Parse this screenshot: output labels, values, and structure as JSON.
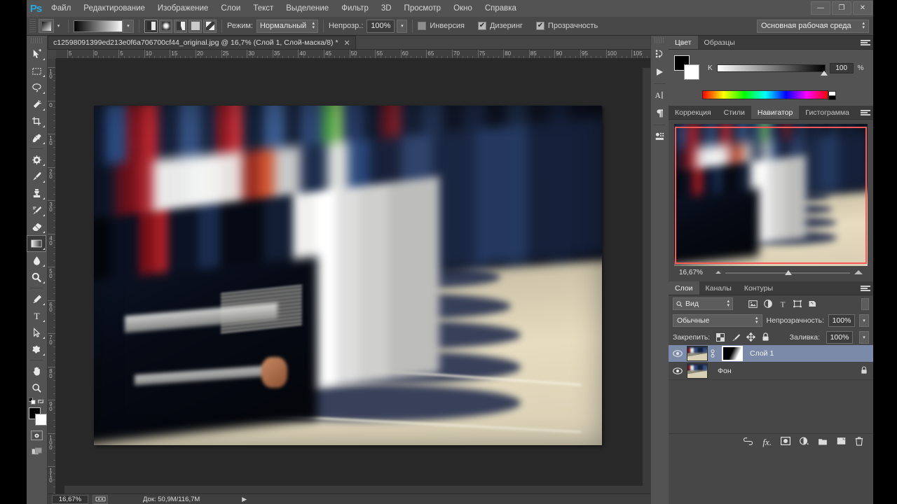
{
  "app": {
    "logo": "Ps"
  },
  "menubar": {
    "items": [
      "Файл",
      "Редактирование",
      "Изображение",
      "Слои",
      "Текст",
      "Выделение",
      "Фильтр",
      "3D",
      "Просмотр",
      "Окно",
      "Справка"
    ],
    "window_buttons": [
      "—",
      "❐",
      "✕"
    ]
  },
  "options_bar": {
    "mode_label": "Режим:",
    "mode_value": "Нормальный",
    "opacity_label": "Непрозр.:",
    "opacity_value": "100%",
    "checkboxes": [
      {
        "label": "Инверсия",
        "checked": false
      },
      {
        "label": "Дизеринг",
        "checked": true
      },
      {
        "label": "Прозрачность",
        "checked": true
      }
    ],
    "gradient_types": [
      "linear-gradient-icon",
      "radial-gradient-icon",
      "angle-gradient-icon",
      "reflected-gradient-icon",
      "diamond-gradient-icon"
    ],
    "workspace": "Основная рабочая среда"
  },
  "toolbar": {
    "tools": [
      {
        "name": "move-tool",
        "active": false
      },
      {
        "name": "rectangular-marquee-tool",
        "active": false
      },
      {
        "name": "lasso-tool",
        "active": false
      },
      {
        "name": "magic-wand-tool",
        "active": false
      },
      {
        "name": "crop-tool",
        "active": false
      },
      {
        "name": "eyedropper-tool",
        "active": false
      },
      {
        "name": "spot-healing-brush-tool",
        "active": false
      },
      {
        "name": "brush-tool",
        "active": false
      },
      {
        "name": "clone-stamp-tool",
        "active": false
      },
      {
        "name": "history-brush-tool",
        "active": false
      },
      {
        "name": "eraser-tool",
        "active": false
      },
      {
        "name": "gradient-tool",
        "active": true
      },
      {
        "name": "blur-tool",
        "active": false
      },
      {
        "name": "dodge-tool",
        "active": false
      },
      {
        "name": "pen-tool",
        "active": false
      },
      {
        "name": "type-tool",
        "active": false
      },
      {
        "name": "path-selection-tool",
        "active": false
      },
      {
        "name": "custom-shape-tool",
        "active": false
      },
      {
        "name": "hand-tool",
        "active": false
      },
      {
        "name": "zoom-tool",
        "active": false
      }
    ],
    "foreground_color": "#000000",
    "background_color": "#ffffff"
  },
  "document": {
    "tab_title": "c12598091399ed213e0f6a706700cf44_original.jpg @ 16,7% (Слой 1, Слой-маска/8) *",
    "close_glyph": "✕",
    "ruler_h_labels": [
      "5",
      "0",
      "5",
      "10",
      "15",
      "20",
      "25",
      "30",
      "35",
      "40",
      "45",
      "50",
      "55",
      "60",
      "65",
      "70",
      "75",
      "80",
      "85",
      "90",
      "95",
      "100",
      "105"
    ],
    "ruler_v_labels": [
      "10",
      "0",
      "10",
      "20",
      "30",
      "40",
      "50",
      "60",
      "70",
      "80",
      "90",
      "100",
      "110"
    ]
  },
  "dock_strip": {
    "buttons": [
      "history-icon",
      "actions-play-icon",
      "character-icon",
      "paragraph-icon",
      "properties-icon"
    ]
  },
  "color_panel": {
    "tabs": [
      {
        "label": "Цвет",
        "active": true
      },
      {
        "label": "Образцы",
        "active": false
      }
    ],
    "channel_label": "K",
    "channel_value": "100",
    "percent_symbol": "%",
    "foreground": "#000000",
    "background": "#ffffff"
  },
  "navigator_panel": {
    "tabs": [
      {
        "label": "Коррекция",
        "active": false
      },
      {
        "label": "Стили",
        "active": false
      },
      {
        "label": "Навигатор",
        "active": true
      },
      {
        "label": "Гистограмма",
        "active": false
      }
    ],
    "zoom_value": "16,67%",
    "view_box_color": "#ff5656"
  },
  "layers_panel": {
    "tabs": [
      {
        "label": "Слои",
        "active": true
      },
      {
        "label": "Каналы",
        "active": false
      },
      {
        "label": "Контуры",
        "active": false
      }
    ],
    "filter_label": "Вид",
    "filter_icons": [
      "pixel-filter-icon",
      "adjustment-filter-icon",
      "type-filter-icon",
      "shape-filter-icon",
      "smart-object-filter-icon"
    ],
    "blend_mode": "Обычные",
    "opacity_label": "Непрозрачность:",
    "opacity_value": "100%",
    "lock_label": "Закрепить:",
    "lock_icons": [
      "lock-transparency-icon",
      "lock-image-icon",
      "lock-position-icon",
      "lock-all-icon"
    ],
    "fill_label": "Заливка:",
    "fill_value": "100%",
    "layers": [
      {
        "name": "Слой 1",
        "visible": true,
        "selected": true,
        "has_mask": true,
        "locked": false
      },
      {
        "name": "Фон",
        "visible": true,
        "selected": false,
        "has_mask": false,
        "locked": true
      }
    ],
    "footer_icons": [
      "link-layers-icon",
      "layer-fx-icon",
      "add-mask-icon",
      "adjustment-layer-icon",
      "new-group-icon",
      "new-layer-icon",
      "delete-layer-icon"
    ]
  },
  "status_bar": {
    "zoom": "16,67%",
    "doc_label": "Док:",
    "doc_value": "50,9M/116,7M",
    "doc_text": "Док: 50,9M/116,7M"
  },
  "colors": {
    "menu_bg": "#535353",
    "panel_bg": "#474747",
    "canvas_bg": "#292929",
    "accent_blue": "#2ba6de",
    "selection_blue": "#7b8aa8"
  }
}
